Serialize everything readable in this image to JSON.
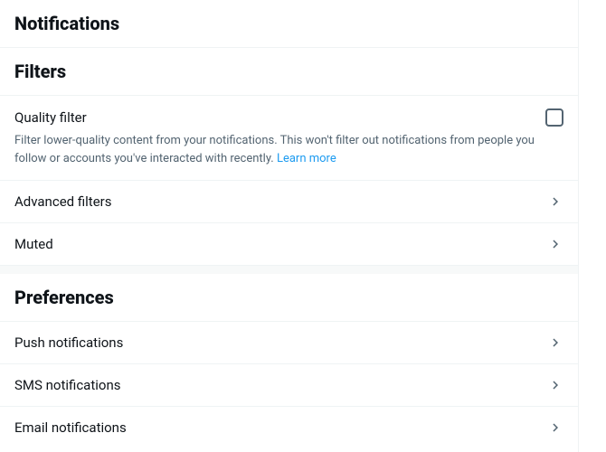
{
  "page": {
    "title": "Notifications"
  },
  "filters": {
    "header": "Filters",
    "quality": {
      "label": "Quality filter",
      "description_a": "Filter lower-quality content from your notifications. This won't filter out notifications from people you follow or accounts you've interacted with recently. ",
      "learn_more": "Learn more",
      "checked": false
    },
    "advanced": {
      "label": "Advanced filters"
    },
    "muted": {
      "label": "Muted"
    }
  },
  "preferences": {
    "header": "Preferences",
    "push": {
      "label": "Push notifications"
    },
    "sms": {
      "label": "SMS notifications"
    },
    "email": {
      "label": "Email notifications"
    }
  }
}
